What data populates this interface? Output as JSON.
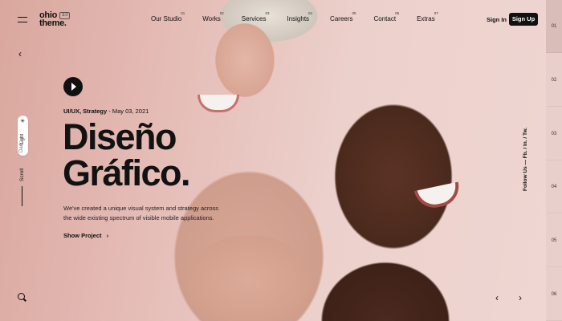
{
  "brand": {
    "logo_line1": "ohio",
    "logo_line2": "theme.",
    "badge": "3.0"
  },
  "nav": [
    {
      "label": "Our Studio",
      "num": "01"
    },
    {
      "label": "Works",
      "num": "02"
    },
    {
      "label": "Services",
      "num": "03"
    },
    {
      "label": "Insights",
      "num": "04"
    },
    {
      "label": "Careers",
      "num": "05"
    },
    {
      "label": "Contact",
      "num": "06"
    },
    {
      "label": "Extras",
      "num": "07"
    }
  ],
  "auth": {
    "signin": "Sign In",
    "signup": "Sign Up"
  },
  "left_rail": {
    "light": "Light",
    "dark": "Dark",
    "scroll": "Scroll"
  },
  "hero": {
    "category": "UI/UX, Strategy",
    "date": " - May 03, 2021",
    "title_line1": "Diseño",
    "title_line2": "Gráfico.",
    "description": "We've created a unique visual system and strategy across the wide existing spectrum of visible mobile applications.",
    "cta": "Show Project"
  },
  "social": {
    "follow": "Follow Us — Fb. / In. / Tw."
  },
  "slides": [
    "01",
    "02",
    "03",
    "04",
    "05",
    "06"
  ],
  "icons": {
    "menu": "menu-icon",
    "prev": "chevron-left-icon",
    "sun": "sun-icon",
    "search": "search-icon",
    "play": "play-icon",
    "arrow_right": "chevron-right-icon"
  },
  "colors": {
    "accent": "#111111",
    "background": "#e5bcb6",
    "index_bg": "#e9cfcb"
  }
}
